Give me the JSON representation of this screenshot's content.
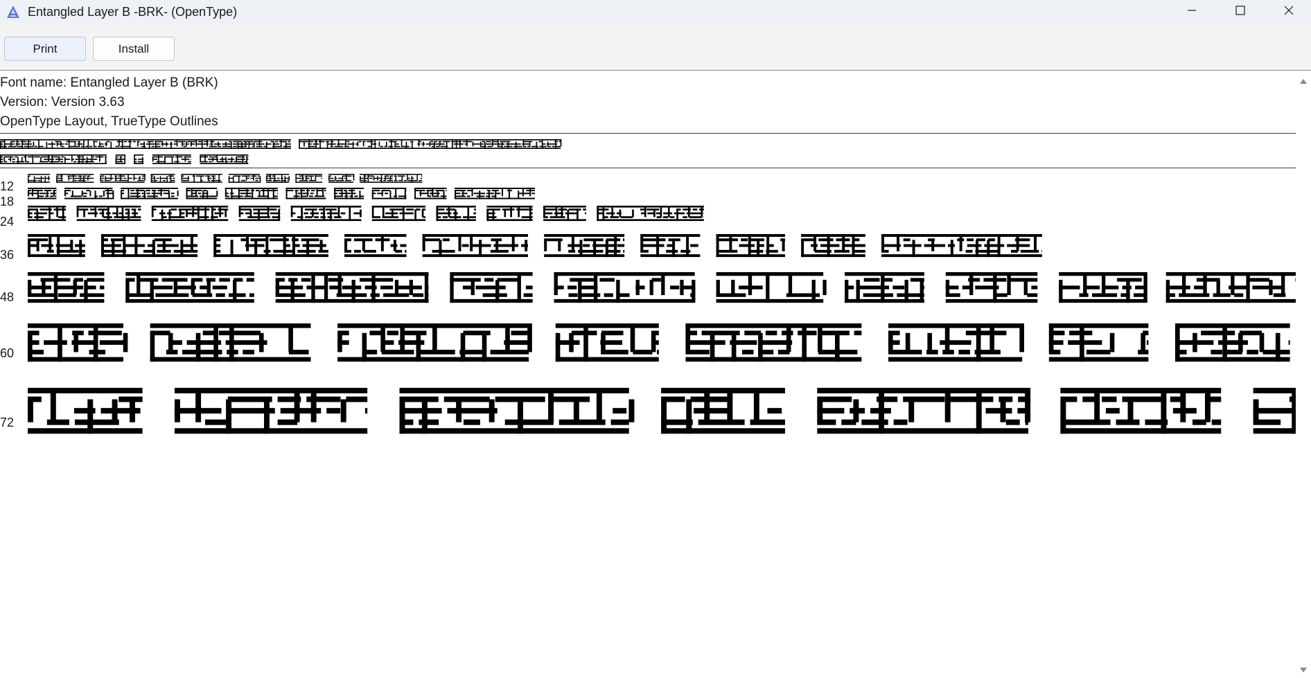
{
  "window": {
    "title": "Entangled Layer B -BRK- (OpenType)",
    "app_icon": "font-viewer-icon",
    "controls": [
      "minimize-icon",
      "maximize-icon",
      "close-icon"
    ]
  },
  "toolbar": {
    "print_label": "Print",
    "install_label": "Install"
  },
  "font_info": {
    "name_line": "Font name: Entangled Layer B (BRK)",
    "version_line": "Version: Version 3.63",
    "type_line": "OpenType Layout, TrueType Outlines"
  },
  "sample_sizes": [
    "12",
    "18",
    "24",
    "36",
    "48",
    "60",
    "72"
  ],
  "colors": {
    "titlebar_bg": "#eef1f6",
    "toolbar_bg": "#f3f3f3",
    "print_button_bg": "#eaf1fb",
    "glyph_ink": "#000000"
  }
}
